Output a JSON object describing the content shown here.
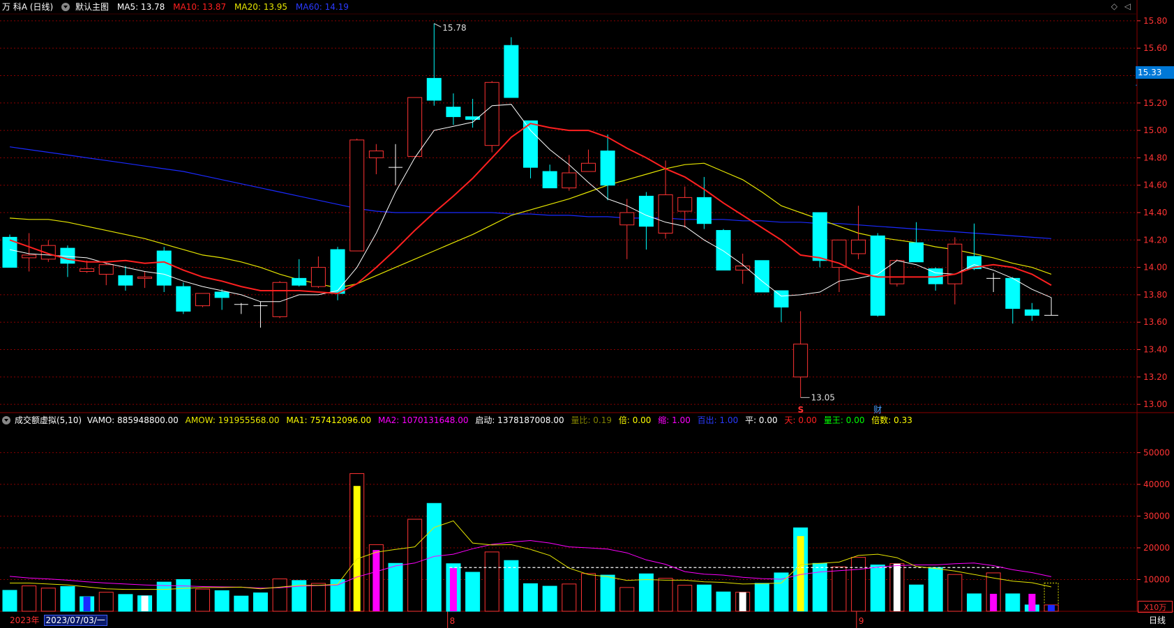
{
  "header": {
    "stock_name": "万 科A (日线)",
    "layout_label": "默认主图",
    "ma5": "MA5: 13.78",
    "ma10": "MA10: 13.87",
    "ma20": "MA20: 13.95",
    "ma60": "MA60: 14.19",
    "corner_icons": [
      "◇",
      "◁"
    ]
  },
  "volume_header": {
    "indicator": "成交额虚拟(5,10)",
    "vamo": "VAMO: 885948800.00",
    "amow": "AMOW: 191955568.00",
    "ma1": "MA1: 757412096.00",
    "ma2": "MA2: 1070131648.00",
    "qidong": "启动: 1378187008.00",
    "liangbi": "量比: 0.19",
    "bei": "倍: 0.00",
    "suo": "缩: 1.00",
    "baichu": "百出: 1.00",
    "ping": "平: 0.00",
    "tian": "天: 0.00",
    "liangwang": "量王: 0.00",
    "beishu": "倍数: 0.33"
  },
  "current_price": "15.33",
  "bottom": {
    "year_label": "2023年",
    "date_label": "2023/07/03/一",
    "month_ticks": [
      "8",
      "9"
    ],
    "period_button": "日线",
    "unit": "X10万"
  },
  "markers": {
    "s_label": "S",
    "cai_label": "财",
    "high_label": "15.78",
    "low_label": "13.05"
  },
  "colors": {
    "up": "#ff3333",
    "down": "#00ffff",
    "doji": "#ffffff",
    "ma5": "#ffffff",
    "ma10": "#ff2020",
    "ma20": "#e6e600",
    "ma60": "#1a2aff",
    "grid": "#8b0000",
    "axis_text": "#ff3333"
  },
  "chart_data": [
    {
      "type": "candlestick",
      "title": "万 科A (日线)",
      "ylim": [
        12.95,
        15.85
      ],
      "y_ticks": [
        "15.80",
        "15.60",
        "15.40",
        "15.20",
        "15.00",
        "14.80",
        "14.60",
        "14.40",
        "14.20",
        "14.00",
        "13.80",
        "13.60",
        "13.40",
        "13.20",
        "13.00"
      ],
      "candles": [
        {
          "o": 14.22,
          "h": 14.24,
          "l": 14.0,
          "c": 14.0
        },
        {
          "o": 14.07,
          "h": 14.25,
          "l": 13.97,
          "c": 14.09
        },
        {
          "o": 14.06,
          "h": 14.2,
          "l": 14.04,
          "c": 14.16
        },
        {
          "o": 14.14,
          "h": 14.16,
          "l": 13.93,
          "c": 14.03
        },
        {
          "o": 13.97,
          "h": 14.05,
          "l": 13.96,
          "c": 13.99
        },
        {
          "o": 13.95,
          "h": 14.03,
          "l": 13.87,
          "c": 14.02
        },
        {
          "o": 13.94,
          "h": 14.01,
          "l": 13.83,
          "c": 13.87
        },
        {
          "o": 13.92,
          "h": 13.97,
          "l": 13.85,
          "c": 13.93
        },
        {
          "o": 14.12,
          "h": 14.15,
          "l": 13.82,
          "c": 13.87
        },
        {
          "o": 13.86,
          "h": 13.89,
          "l": 13.66,
          "c": 13.68
        },
        {
          "o": 13.72,
          "h": 13.81,
          "l": 13.71,
          "c": 13.81
        },
        {
          "o": 13.82,
          "h": 13.84,
          "l": 13.69,
          "c": 13.78
        },
        {
          "o": 13.73,
          "h": 13.74,
          "l": 13.66,
          "c": 13.73
        },
        {
          "o": 13.72,
          "h": 13.75,
          "l": 13.56,
          "c": 13.72
        },
        {
          "o": 13.64,
          "h": 13.9,
          "l": 13.63,
          "c": 13.89
        },
        {
          "o": 13.92,
          "h": 14.06,
          "l": 13.86,
          "c": 13.87
        },
        {
          "o": 13.86,
          "h": 14.08,
          "l": 13.85,
          "c": 14.0
        },
        {
          "o": 14.13,
          "h": 14.15,
          "l": 13.76,
          "c": 13.81
        },
        {
          "o": 14.12,
          "h": 14.94,
          "l": 14.12,
          "c": 14.93
        },
        {
          "o": 14.8,
          "h": 14.9,
          "l": 14.68,
          "c": 14.85
        },
        {
          "o": 14.73,
          "h": 14.9,
          "l": 14.6,
          "c": 14.73
        },
        {
          "o": 14.81,
          "h": 15.21,
          "l": 14.81,
          "c": 15.24
        },
        {
          "o": 15.38,
          "h": 15.78,
          "l": 15.18,
          "c": 15.22
        },
        {
          "o": 15.17,
          "h": 15.27,
          "l": 15.04,
          "c": 15.1
        },
        {
          "o": 15.1,
          "h": 15.23,
          "l": 15.02,
          "c": 15.08
        },
        {
          "o": 14.89,
          "h": 15.36,
          "l": 14.84,
          "c": 15.35
        },
        {
          "o": 15.62,
          "h": 15.68,
          "l": 15.24,
          "c": 15.24
        },
        {
          "o": 15.07,
          "h": 15.07,
          "l": 14.65,
          "c": 14.73
        },
        {
          "o": 14.7,
          "h": 14.75,
          "l": 14.58,
          "c": 14.58
        },
        {
          "o": 14.58,
          "h": 14.82,
          "l": 14.56,
          "c": 14.69
        },
        {
          "o": 14.7,
          "h": 14.86,
          "l": 14.7,
          "c": 14.76
        },
        {
          "o": 14.85,
          "h": 14.97,
          "l": 14.49,
          "c": 14.6
        },
        {
          "o": 14.31,
          "h": 14.5,
          "l": 14.06,
          "c": 14.4
        },
        {
          "o": 14.52,
          "h": 14.55,
          "l": 14.13,
          "c": 14.3
        },
        {
          "o": 14.25,
          "h": 14.78,
          "l": 14.21,
          "c": 14.53
        },
        {
          "o": 14.41,
          "h": 14.59,
          "l": 14.29,
          "c": 14.51
        },
        {
          "o": 14.51,
          "h": 14.66,
          "l": 14.28,
          "c": 14.32
        },
        {
          "o": 14.27,
          "h": 14.28,
          "l": 13.98,
          "c": 13.98
        },
        {
          "o": 13.98,
          "h": 14.1,
          "l": 13.88,
          "c": 14.01
        },
        {
          "o": 14.05,
          "h": 14.05,
          "l": 13.82,
          "c": 13.82
        },
        {
          "o": 13.83,
          "h": 13.83,
          "l": 13.6,
          "c": 13.71
        },
        {
          "o": 13.2,
          "h": 13.68,
          "l": 13.05,
          "c": 13.44
        },
        {
          "o": 14.4,
          "h": 14.4,
          "l": 14.0,
          "c": 14.05
        },
        {
          "o": 14.0,
          "h": 14.2,
          "l": 13.82,
          "c": 14.2
        },
        {
          "o": 14.1,
          "h": 14.45,
          "l": 14.06,
          "c": 14.2
        },
        {
          "o": 14.23,
          "h": 14.25,
          "l": 13.64,
          "c": 13.65
        },
        {
          "o": 13.88,
          "h": 14.06,
          "l": 13.86,
          "c": 14.05
        },
        {
          "o": 14.18,
          "h": 14.33,
          "l": 14.04,
          "c": 14.04
        },
        {
          "o": 13.99,
          "h": 14.0,
          "l": 13.83,
          "c": 13.88
        },
        {
          "o": 13.88,
          "h": 14.22,
          "l": 13.73,
          "c": 14.17
        },
        {
          "o": 14.08,
          "h": 14.32,
          "l": 13.98,
          "c": 13.99
        },
        {
          "o": 13.92,
          "h": 13.96,
          "l": 13.82,
          "c": 13.92
        },
        {
          "o": 13.92,
          "h": 13.93,
          "l": 13.59,
          "c": 13.7
        },
        {
          "o": 13.69,
          "h": 13.74,
          "l": 13.61,
          "c": 13.65
        },
        {
          "o": 13.65,
          "h": 13.78,
          "l": 13.65,
          "c": 13.65
        }
      ],
      "ma5": [
        14.13,
        14.1,
        14.09,
        14.08,
        14.07,
        14.03,
        14.0,
        13.97,
        13.95,
        13.9,
        13.86,
        13.83,
        13.8,
        13.75,
        13.75,
        13.8,
        13.8,
        13.83,
        14.0,
        14.25,
        14.55,
        14.8,
        15.0,
        15.03,
        15.06,
        15.18,
        15.19,
        15.0,
        14.86,
        14.75,
        14.62,
        14.5,
        14.45,
        14.38,
        14.33,
        14.3,
        14.2,
        14.12,
        14.02,
        13.9,
        13.79,
        13.8,
        13.82,
        13.9,
        13.92,
        13.95,
        14.05,
        14.02,
        13.96,
        13.95,
        14.02,
        13.98,
        13.92,
        13.84,
        13.78
      ],
      "ma10": [
        14.2,
        14.15,
        14.1,
        14.06,
        14.04,
        14.04,
        14.05,
        14.03,
        14.04,
        13.98,
        13.93,
        13.9,
        13.86,
        13.83,
        13.83,
        13.83,
        13.82,
        13.81,
        13.88,
        14.0,
        14.13,
        14.27,
        14.4,
        14.52,
        14.65,
        14.8,
        14.95,
        15.05,
        15.02,
        15.0,
        15.0,
        14.95,
        14.87,
        14.8,
        14.72,
        14.66,
        14.57,
        14.47,
        14.38,
        14.29,
        14.2,
        14.09,
        14.07,
        14.03,
        13.96,
        13.93,
        13.93,
        13.93,
        13.93,
        13.95,
        14.0,
        14.02,
        14.0,
        13.95,
        13.87
      ],
      "ma20": [
        14.36,
        14.35,
        14.35,
        14.33,
        14.3,
        14.27,
        14.24,
        14.21,
        14.17,
        14.13,
        14.09,
        14.07,
        14.04,
        14.0,
        13.95,
        13.91,
        13.88,
        13.85,
        13.88,
        13.94,
        14.0,
        14.06,
        14.12,
        14.18,
        14.24,
        14.31,
        14.38,
        14.42,
        14.46,
        14.5,
        14.55,
        14.6,
        14.64,
        14.68,
        14.72,
        14.75,
        14.76,
        14.7,
        14.64,
        14.55,
        14.45,
        14.4,
        14.35,
        14.3,
        14.25,
        14.22,
        14.2,
        14.18,
        14.15,
        14.13,
        14.1,
        14.07,
        14.03,
        14.0,
        13.95
      ],
      "ma60": [
        14.88,
        14.86,
        14.84,
        14.82,
        14.8,
        14.78,
        14.76,
        14.74,
        14.72,
        14.7,
        14.67,
        14.64,
        14.61,
        14.58,
        14.55,
        14.52,
        14.49,
        14.46,
        14.43,
        14.41,
        14.4,
        14.4,
        14.4,
        14.4,
        14.4,
        14.4,
        14.39,
        14.39,
        14.38,
        14.38,
        14.37,
        14.37,
        14.36,
        14.36,
        14.36,
        14.35,
        14.35,
        14.35,
        14.34,
        14.34,
        14.33,
        14.33,
        14.32,
        14.32,
        14.31,
        14.3,
        14.29,
        14.28,
        14.27,
        14.26,
        14.25,
        14.24,
        14.23,
        14.22,
        14.21
      ],
      "annotations": [
        {
          "text": "15.78",
          "index": 22,
          "price": 15.78
        },
        {
          "text": "13.05",
          "index": 41,
          "price": 13.05
        },
        {
          "text": "S",
          "index": 41
        },
        {
          "text": "财",
          "index": 45
        }
      ]
    },
    {
      "type": "bar",
      "title": "成交额虚拟(5,10)",
      "ylim": [
        0,
        58000
      ],
      "y_ticks": [
        "50000",
        "40000",
        "30000",
        "20000",
        "10000"
      ],
      "values": [
        6600,
        8000,
        7300,
        7800,
        4600,
        6000,
        5300,
        4900,
        9200,
        10000,
        7000,
        6500,
        4800,
        5800,
        10200,
        9700,
        8800,
        10000,
        43400,
        21000,
        15100,
        29000,
        34000,
        15000,
        12300,
        18700,
        16000,
        8700,
        7900,
        8600,
        11900,
        11400,
        7500,
        11800,
        10400,
        8200,
        8300,
        6100,
        6000,
        8800,
        12100,
        26300,
        15100,
        14000,
        17000,
        14600,
        15000,
        8300,
        13800,
        11600,
        5500,
        12100,
        5500,
        2000,
        2000
      ],
      "overlay_bars": [
        {
          "index": 4,
          "value": 4600,
          "color": "#1a2aff"
        },
        {
          "index": 7,
          "value": 4900,
          "color": "#ffffff"
        },
        {
          "index": 18,
          "value": 39500,
          "color": "#ffff00"
        },
        {
          "index": 19,
          "value": 19300,
          "color": "#ff00ff"
        },
        {
          "index": 23,
          "value": 13600,
          "color": "#ff00ff"
        },
        {
          "index": 38,
          "value": 6000,
          "color": "#ffffff"
        },
        {
          "index": 41,
          "value": 23700,
          "color": "#ffff00"
        },
        {
          "index": 46,
          "value": 15000,
          "color": "#ffffff"
        },
        {
          "index": 51,
          "value": 5500,
          "color": "#ff00ff"
        },
        {
          "index": 53,
          "value": 5500,
          "color": "#ff00ff"
        },
        {
          "index": 54,
          "value": 2000,
          "color": "#1a2aff"
        }
      ],
      "up_flags": [
        0,
        1,
        1,
        0,
        0,
        1,
        0,
        0,
        0,
        0,
        1,
        0,
        0,
        0,
        1,
        0,
        1,
        0,
        1,
        1,
        0,
        1,
        0,
        0,
        0,
        1,
        0,
        0,
        0,
        1,
        1,
        0,
        1,
        0,
        1,
        1,
        0,
        0,
        1,
        0,
        0,
        0,
        0,
        1,
        1,
        0,
        1,
        0,
        0,
        1,
        0,
        1,
        0,
        0,
        1
      ],
      "ma1": [
        8900,
        8900,
        8600,
        8300,
        7700,
        7100,
        6900,
        6900,
        6900,
        7200,
        7500,
        7500,
        7600,
        7100,
        7600,
        8200,
        8200,
        8500,
        16500,
        18600,
        19500,
        20300,
        26400,
        28500,
        21500,
        20900,
        21000,
        19500,
        17600,
        13600,
        11600,
        10900,
        9700,
        10000,
        9800,
        9800,
        9300,
        9100,
        8600,
        8700,
        8900,
        14700,
        15100,
        15500,
        17600,
        18000,
        16900,
        14100,
        13500,
        12700,
        11600,
        10500,
        9500,
        9000,
        7700
      ],
      "ma2": [
        11000,
        10500,
        10200,
        9800,
        9300,
        8900,
        8600,
        8300,
        8100,
        8000,
        7800,
        7700,
        7600,
        7300,
        7400,
        7900,
        8100,
        8300,
        10800,
        12500,
        14300,
        15200,
        17300,
        18000,
        19700,
        21100,
        21800,
        22300,
        21500,
        20300,
        20000,
        19600,
        18400,
        16200,
        14800,
        12500,
        11700,
        11400,
        10700,
        10300,
        10100,
        11600,
        12400,
        12800,
        13200,
        13900,
        14400,
        14600,
        14600,
        15000,
        15200,
        14400,
        13100,
        12200,
        10900
      ],
      "threshold": 13781
    }
  ]
}
